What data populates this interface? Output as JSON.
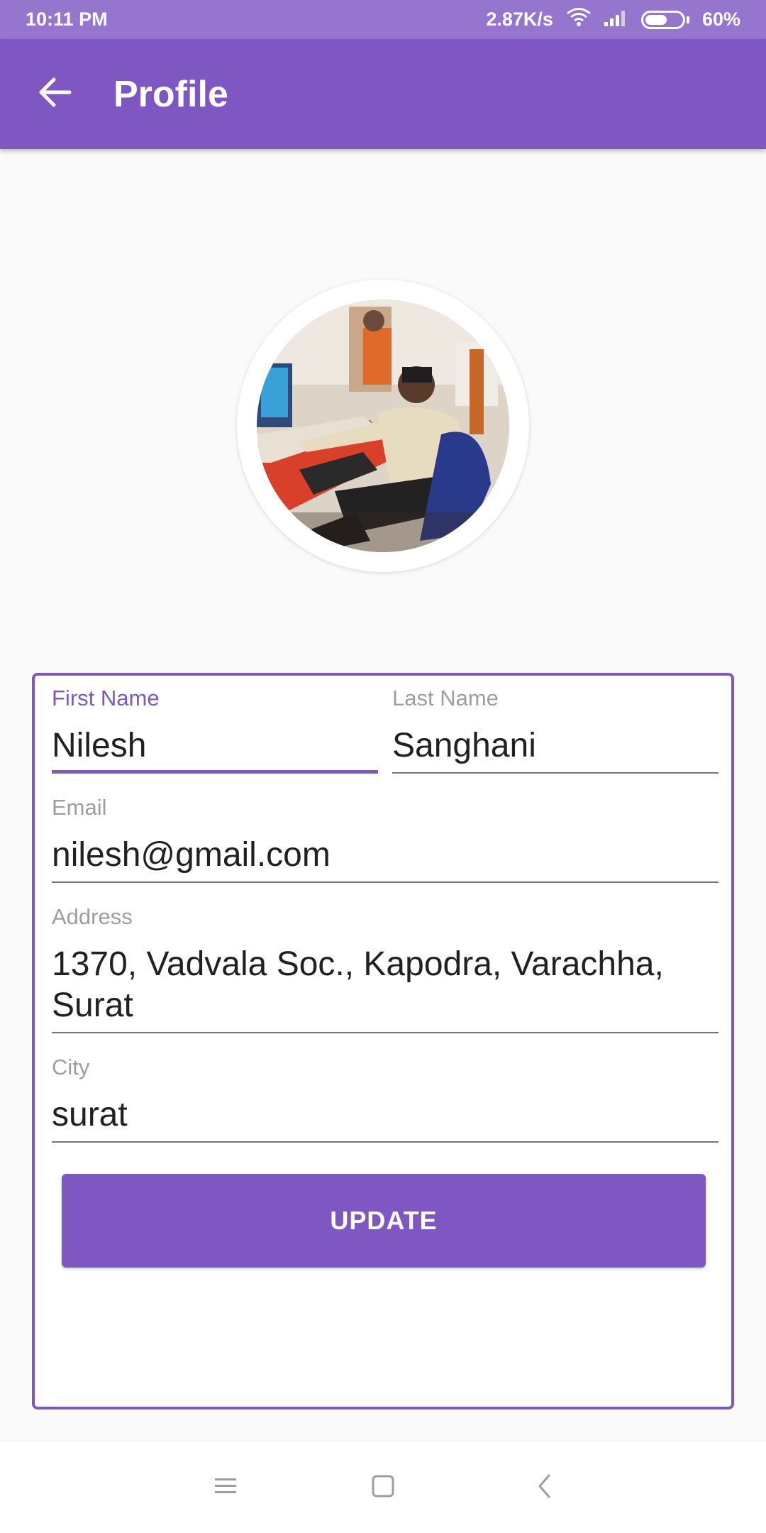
{
  "status_bar": {
    "time": "10:11 PM",
    "network_speed": "2.87K/s",
    "battery": "60%",
    "icons": [
      "wifi-icon",
      "signal-icon",
      "battery-icon"
    ]
  },
  "app_bar": {
    "title": "Profile",
    "back_icon": "arrow-left-icon"
  },
  "form": {
    "first_name": {
      "label": "First Name",
      "value": "Nilesh"
    },
    "last_name": {
      "label": "Last Name",
      "value": "Sanghani"
    },
    "email": {
      "label": "Email",
      "value": "nilesh@gmail.com"
    },
    "address": {
      "label": "Address",
      "value": "1370, Vadvala Soc., Kapodra, Varachha,\nSurat"
    },
    "city": {
      "label": "City",
      "value": "surat"
    },
    "update_label": "UPDATE"
  },
  "nav_bar": {
    "icons": [
      "menu-icon",
      "home-icon",
      "back-icon"
    ]
  },
  "colors": {
    "primary": "#7e57c2",
    "status_bar": "#9575cd",
    "background": "#fafafa"
  }
}
